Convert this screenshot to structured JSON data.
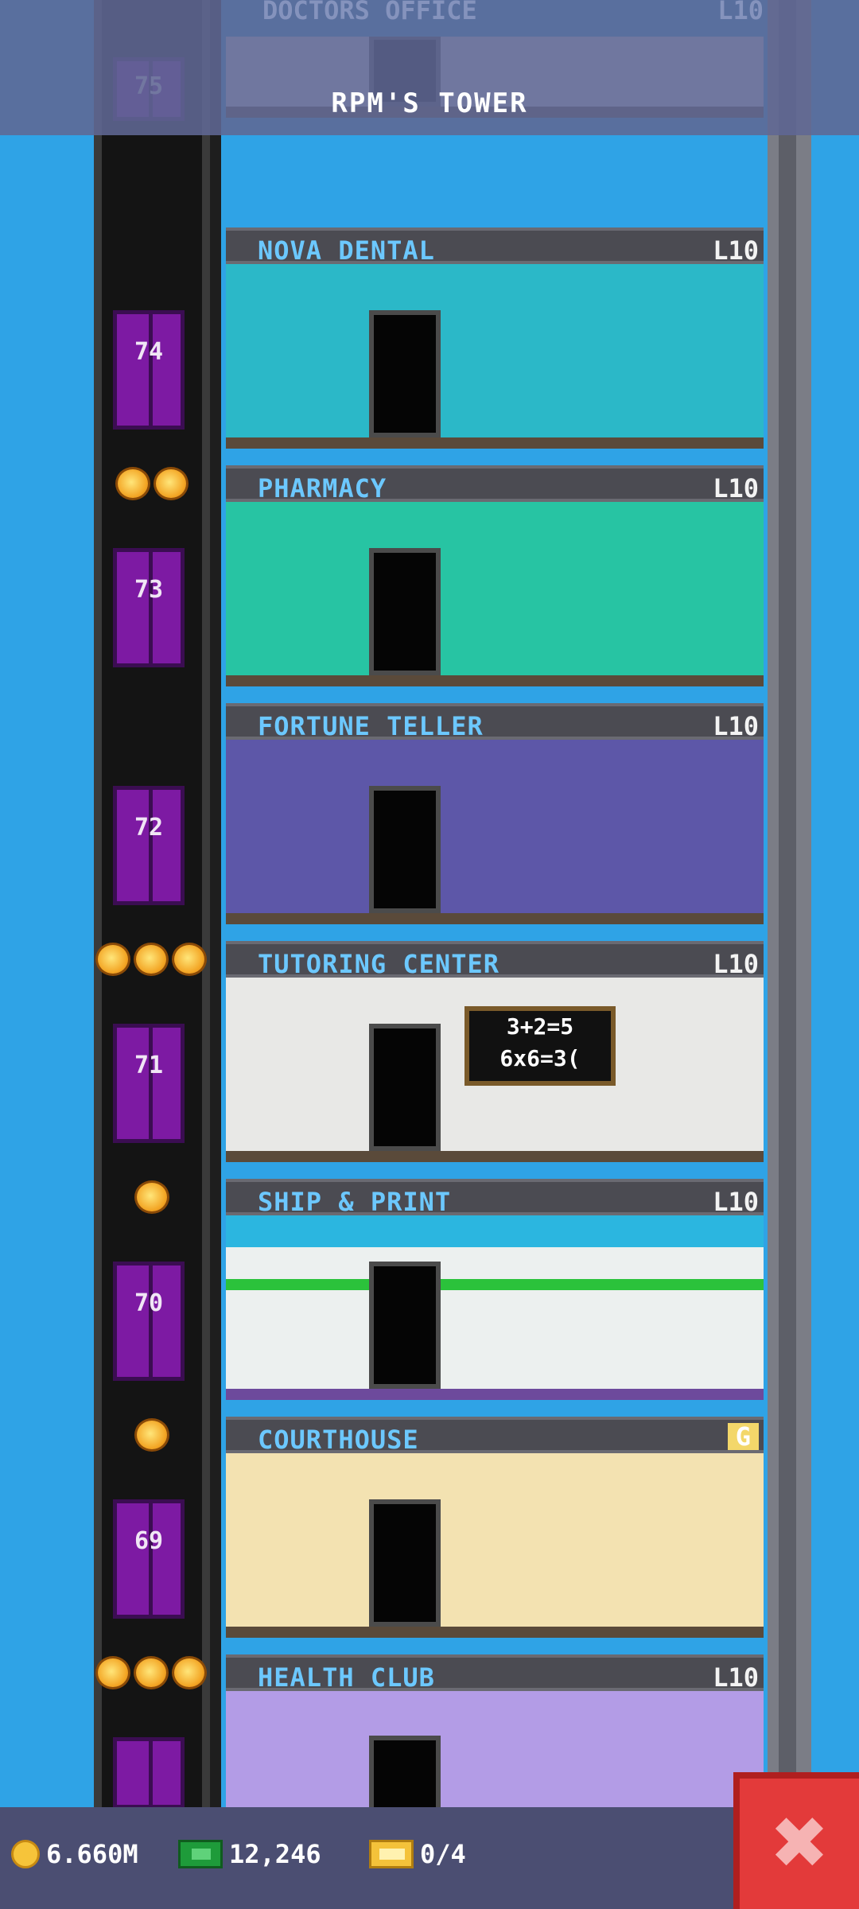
{
  "header": {
    "title": "RPM'S TOWER",
    "top_floor_name": "DOCTORS OFFICE",
    "top_floor_level": "L10"
  },
  "floors": [
    {
      "name": "NOVA DENTAL",
      "level": "L10",
      "elevator_number": "74",
      "stars": 0,
      "theme": "dental"
    },
    {
      "name": "PHARMACY",
      "level": "L10",
      "elevator_number": "73",
      "stars": 2,
      "theme": "pharm"
    },
    {
      "name": "FORTUNE TELLER",
      "level": "L10",
      "elevator_number": "72",
      "stars": 0,
      "theme": "fortune"
    },
    {
      "name": "TUTORING CENTER",
      "level": "L10",
      "elevator_number": "71",
      "stars": 3,
      "theme": "tutor"
    },
    {
      "name": "SHIP & PRINT",
      "level": "L10",
      "elevator_number": "70",
      "stars": 1,
      "theme": "ship"
    },
    {
      "name": "COURTHOUSE",
      "level": "G",
      "elevator_number": "69",
      "stars": 1,
      "theme": "court"
    },
    {
      "name": "HEALTH CLUB",
      "level": "L10",
      "elevator_number": "",
      "stars": 3,
      "theme": "health"
    }
  ],
  "doctors_office": {
    "elevator_number": "75"
  },
  "tutoring_chalkboard": {
    "line1": "3+2=5",
    "line2": "6x6=3("
  },
  "status": {
    "coins": "6.660M",
    "bux": "12,246",
    "tickets": "0/4"
  },
  "icons": {
    "coins": "coin-icon",
    "bux": "bux-icon",
    "tickets": "ticket-icon",
    "close": "close-icon"
  },
  "close_glyph": "✖"
}
